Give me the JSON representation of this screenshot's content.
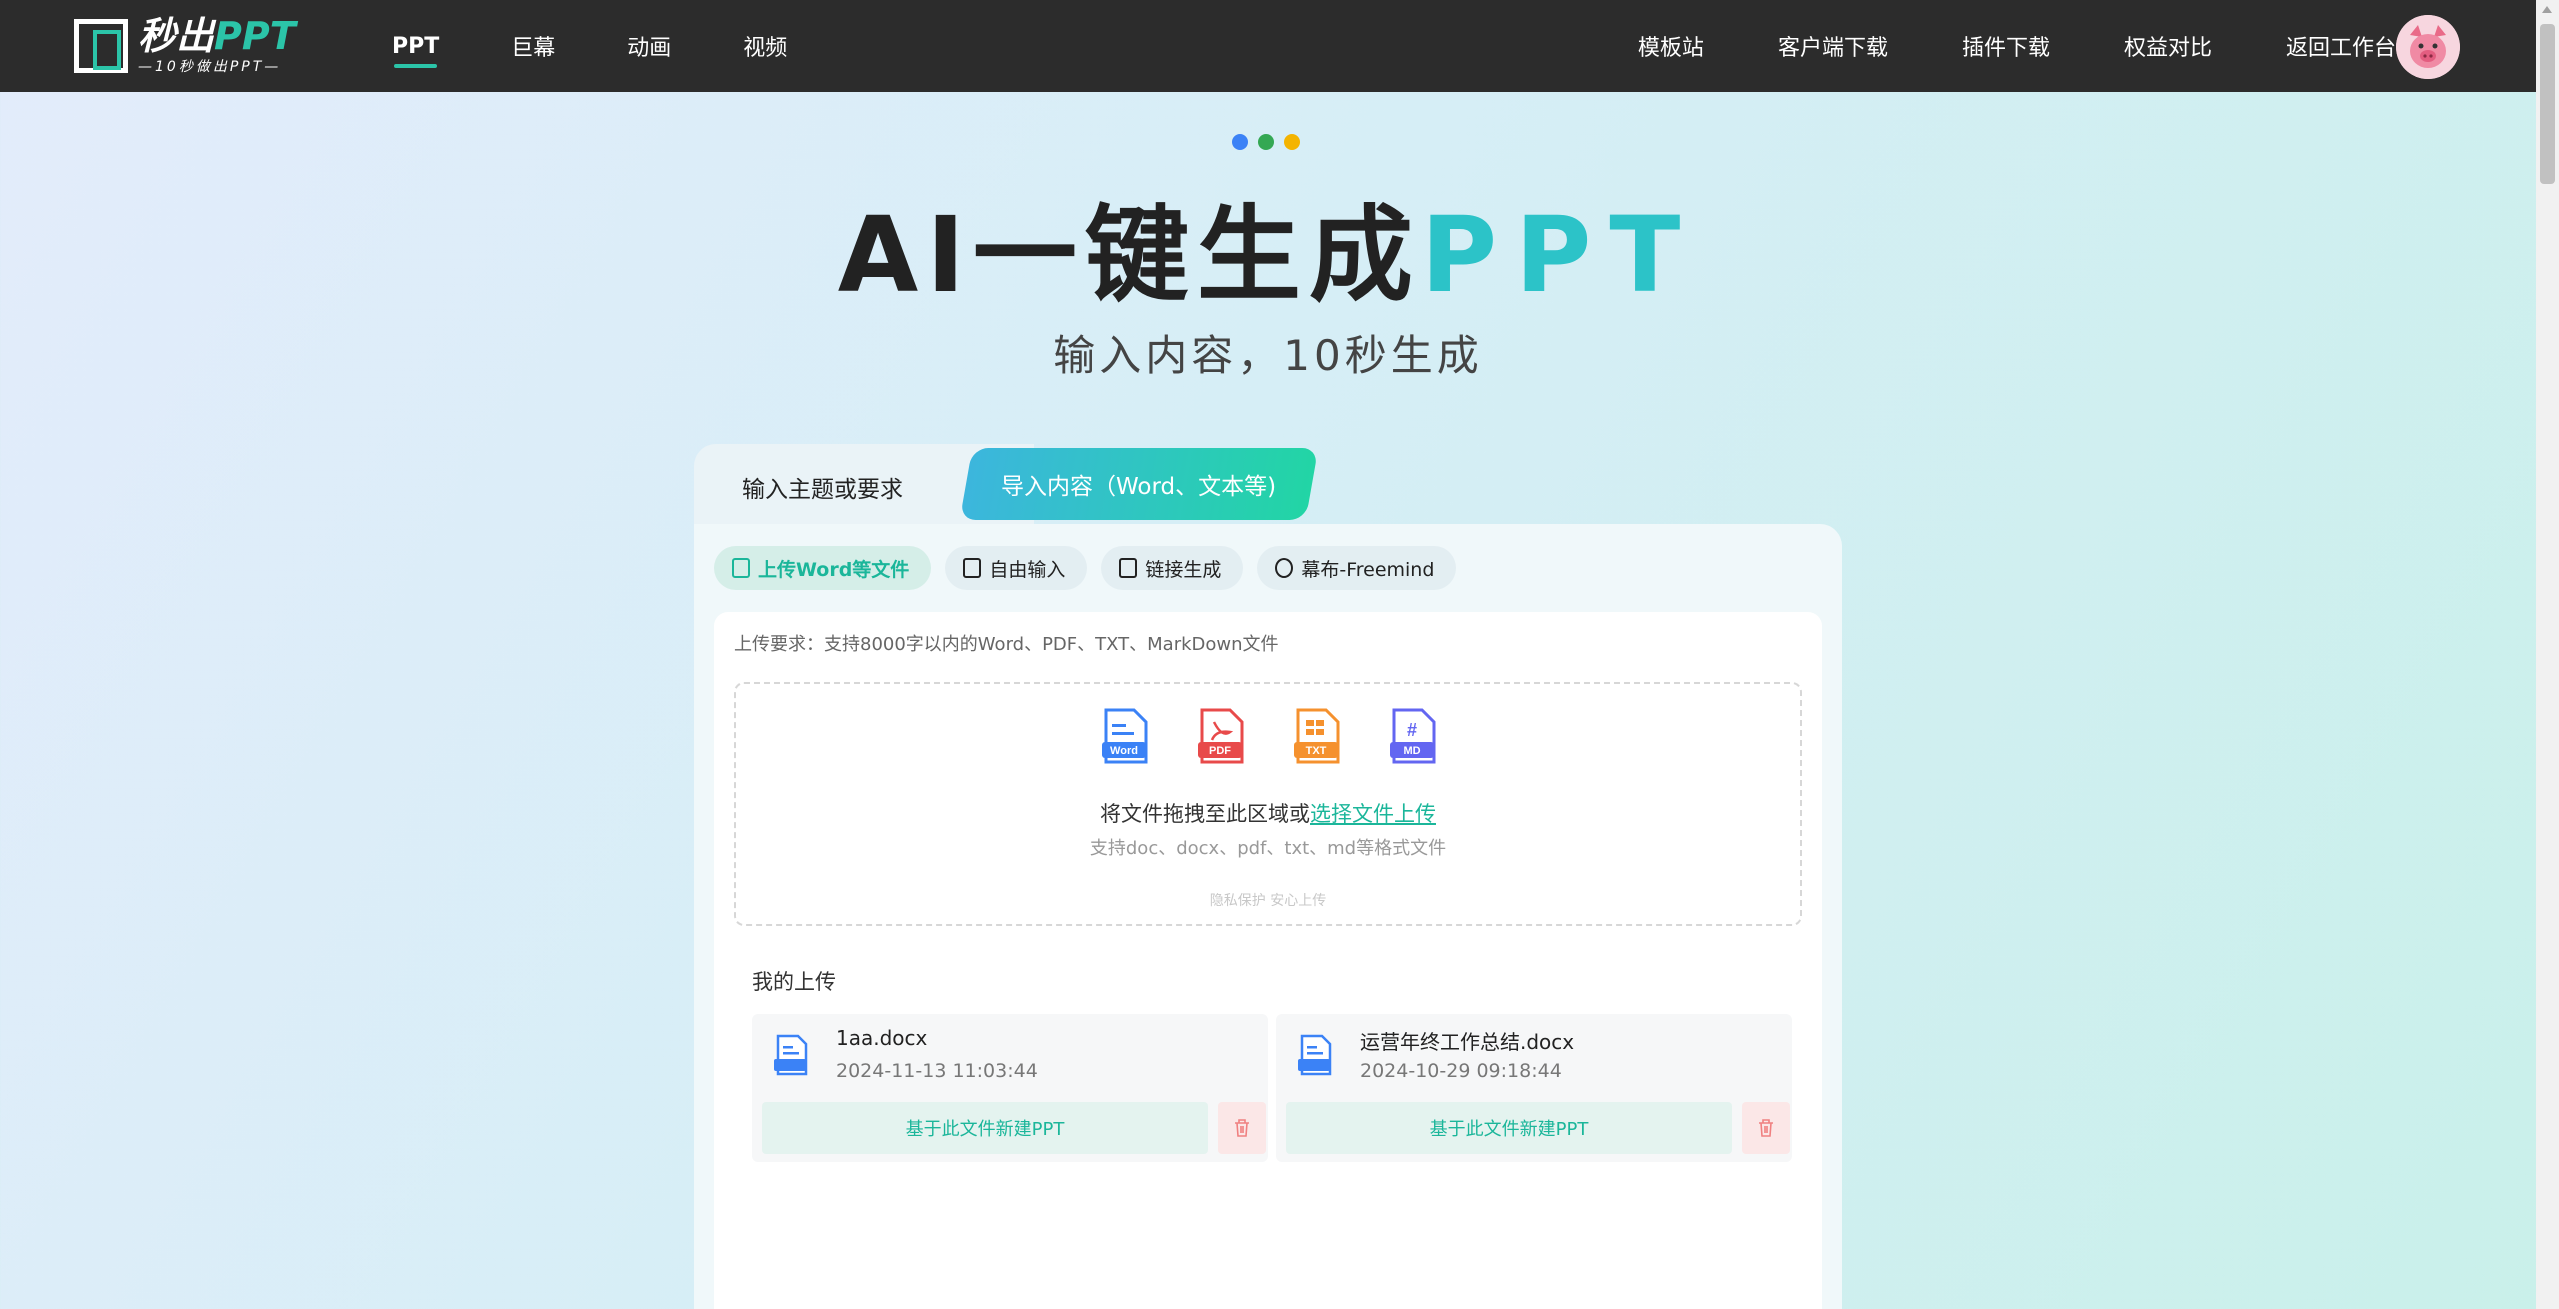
{
  "header": {
    "logo_title_main": "秒出",
    "logo_title_accent": "PPT",
    "logo_subtitle": "—10秒做出PPT—",
    "nav_left": [
      "PPT",
      "巨幕",
      "动画",
      "视频"
    ],
    "nav_right": [
      "模板站",
      "客户端下载",
      "插件下载",
      "权益对比",
      "返回工作台"
    ]
  },
  "hero": {
    "title_main": "AI一键生成",
    "title_accent": "PPT",
    "subtitle": "输入内容，10秒生成"
  },
  "tabs": {
    "tab1": "输入主题或要求",
    "tab2": "导入内容（Word、文本等)"
  },
  "chips": [
    "上传Word等文件",
    "自由输入",
    "链接生成",
    "幕布-Freemind"
  ],
  "upload": {
    "requirement": "上传要求：支持8000字以内的Word、PDF、TXT、MarkDown文件",
    "icon_labels": [
      "Word",
      "PDF",
      "TXT",
      "MD"
    ],
    "drop_text": "将文件拖拽至此区域或",
    "drop_link": "选择文件上传",
    "drop_hint": "支持doc、docx、pdf、txt、md等格式文件",
    "privacy": "隐私保护 安心上传"
  },
  "my_uploads": {
    "title": "我的上传",
    "files": [
      {
        "name": "1aa.docx",
        "time": "2024-11-13 11:03:44",
        "action": "基于此文件新建PPT"
      },
      {
        "name": "运营年终工作总结.docx",
        "time": "2024-10-29 09:18:44",
        "action": "基于此文件新建PPT"
      }
    ]
  },
  "colors": {
    "accent": "#2bc4a8",
    "dot_blue": "#3b82f6",
    "dot_green": "#34a853",
    "dot_yellow": "#f4b400"
  }
}
